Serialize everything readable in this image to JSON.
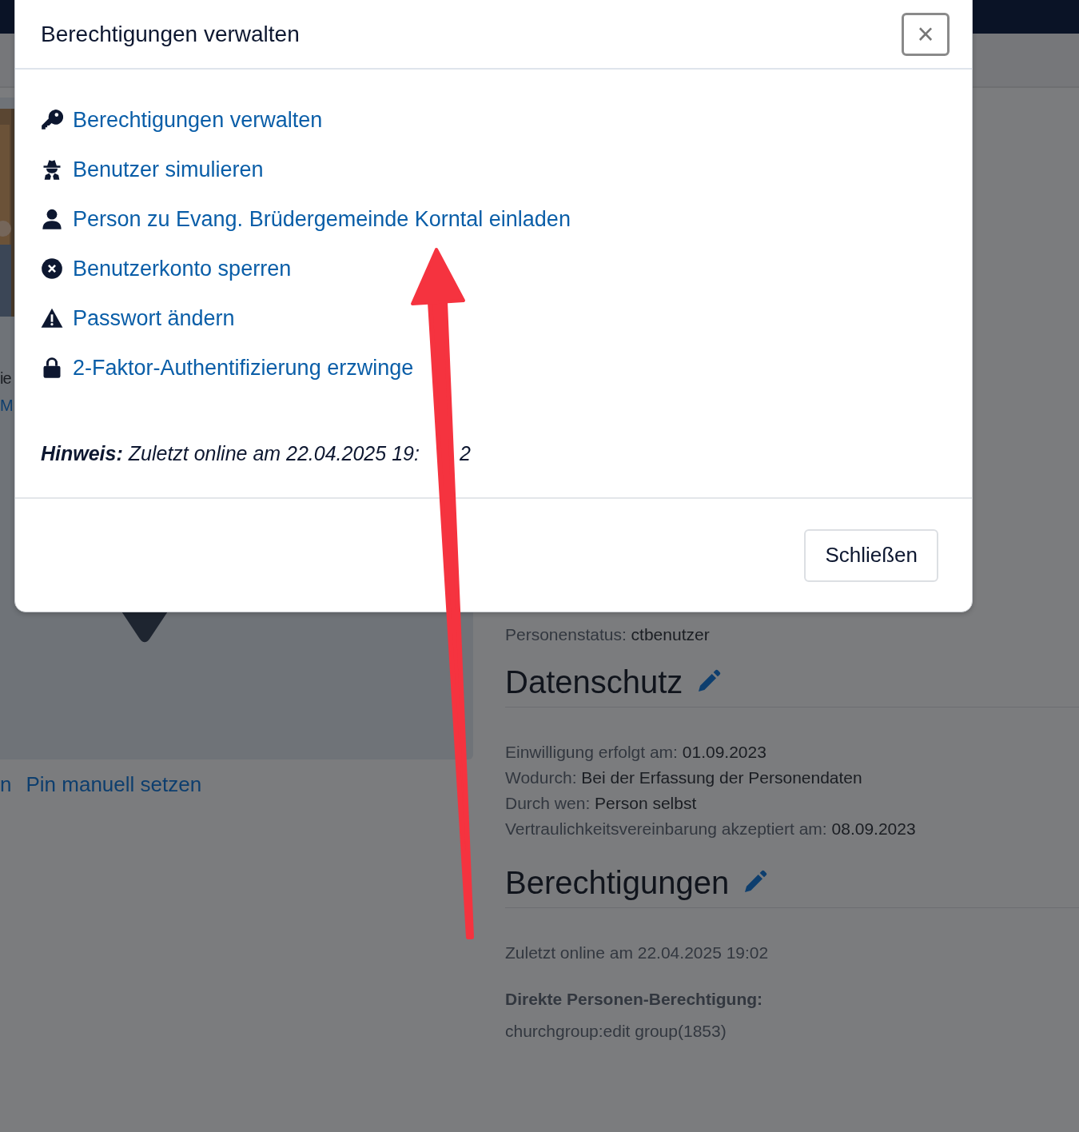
{
  "modal": {
    "title": "Berechtigungen verwalten",
    "close": "×",
    "actions": [
      {
        "kind": "key",
        "label": "Berechtigungen verwalten"
      },
      {
        "kind": "spy",
        "label": "Benutzer simulieren"
      },
      {
        "kind": "user",
        "label": "Person zu Evang. Brüdergemeinde Korntal einladen"
      },
      {
        "kind": "block",
        "label": "Benutzerkonto sperren"
      },
      {
        "kind": "warning",
        "label": "Passwort ändern"
      },
      {
        "kind": "lock",
        "label": "2-Faktor-Authentifizierung erzwinge"
      }
    ],
    "note": "**Hinweis:** Zuletzt online am 22.04.2025 19:",
    "note_end": "2",
    "footer_button": "Schließen"
  },
  "background": {
    "left_fragments": [
      "ie",
      "M"
    ],
    "links": [
      "n",
      "Pin manuell setzen"
    ],
    "status": {
      "label": "Personenstatus:",
      "value": "ctbenutzer"
    },
    "sections": [
      {
        "title": "Datenschutz",
        "items": [
          {
            "kind": "field",
            "label": "Einwilligung erfolgt am:",
            "value": "01.09.2023"
          },
          {
            "kind": "field",
            "label": "Wodurch:",
            "value": "Bei der Erfassung der Personendaten"
          },
          {
            "kind": "field",
            "label": "Durch wen:",
            "value": "Person selbst"
          },
          {
            "kind": "field",
            "label": "Vertraulichkeitsvereinbarung akzeptiert am:",
            "value": "08.09.2023"
          }
        ]
      },
      {
        "title": "Berechtigungen",
        "items": [
          {
            "kind": "text",
            "text": "Zuletzt online am 22.04.2025 19:02"
          },
          {
            "kind": "heading",
            "text": "Direkte Personen-Berechtigung:"
          },
          {
            "kind": "text",
            "text": "churchgroup:edit group(1853)"
          }
        ]
      }
    ]
  }
}
